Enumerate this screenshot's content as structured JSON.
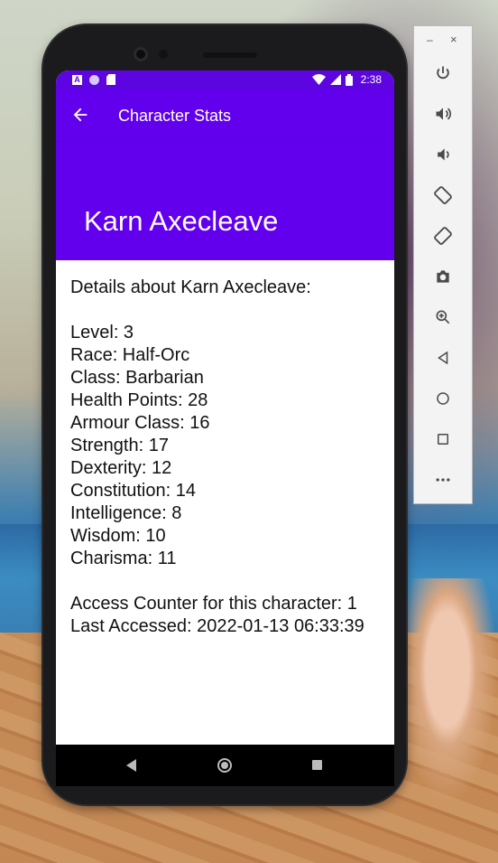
{
  "status_bar": {
    "time": "2:38",
    "icon_a": "A"
  },
  "app_bar": {
    "title": "Character Stats",
    "headline": "Karn Axecleave"
  },
  "details": {
    "intro": "Details about Karn Axecleave:",
    "stats": [
      "Level: 3",
      "Race: Half-Orc",
      "Class: Barbarian",
      "Health Points: 28",
      "Armour Class: 16",
      "Strength: 17",
      "Dexterity: 12",
      "Constitution: 14",
      "Intelligence: 8",
      "Wisdom: 10",
      "Charisma: 11"
    ],
    "access_counter": "Access Counter for this character: 1",
    "last_accessed": "Last Accessed: 2022-01-13 06:33:39"
  },
  "emulator_toolbar": {
    "minimize": "–",
    "close": "×",
    "buttons": [
      "power-icon",
      "volume-up-icon",
      "volume-down-icon",
      "rotate-left-icon",
      "rotate-right-icon",
      "camera-icon",
      "zoom-icon",
      "back-icon",
      "home-icon",
      "overview-icon",
      "more-icon"
    ]
  },
  "colors": {
    "app_bar": "#6200ee",
    "status_bar": "#5d05e0"
  }
}
